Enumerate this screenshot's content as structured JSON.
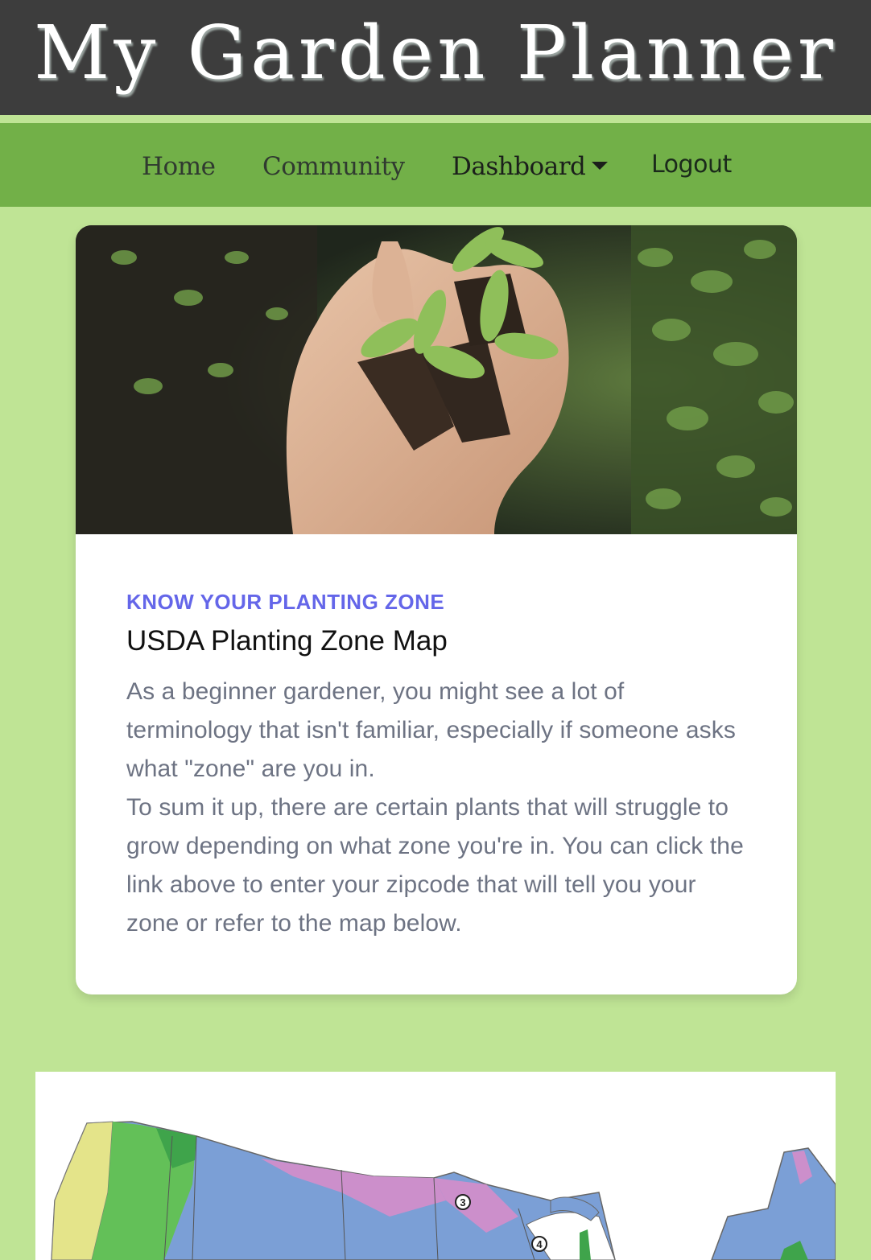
{
  "header": {
    "title": "My Garden Planner"
  },
  "nav": {
    "home": "Home",
    "community": "Community",
    "dashboard": "Dashboard",
    "logout": "Logout"
  },
  "card": {
    "eyebrow": "KNOW YOUR PLANTING ZONE",
    "title": "USDA Planting Zone Map",
    "paragraph_1": "As a beginner gardener, you might see a lot of terminology that isn't familiar, especially if someone asks what \"zone\" are you in.",
    "paragraph_2": "To sum it up, there are certain plants that will struggle to grow depending on what zone you're in. You can click the link above to enter your zipcode that will tell you your zone or refer to the map below."
  },
  "map": {
    "zone_labels": [
      "3",
      "4"
    ]
  },
  "colors": {
    "header_bg": "#3d3d3d",
    "nav_bg": "#72b048",
    "page_bg": "#bfe495",
    "eyebrow": "#6466e9",
    "body_text": "#6d7383"
  },
  "icons": {
    "dashboard_caret": "caret-down-icon"
  }
}
